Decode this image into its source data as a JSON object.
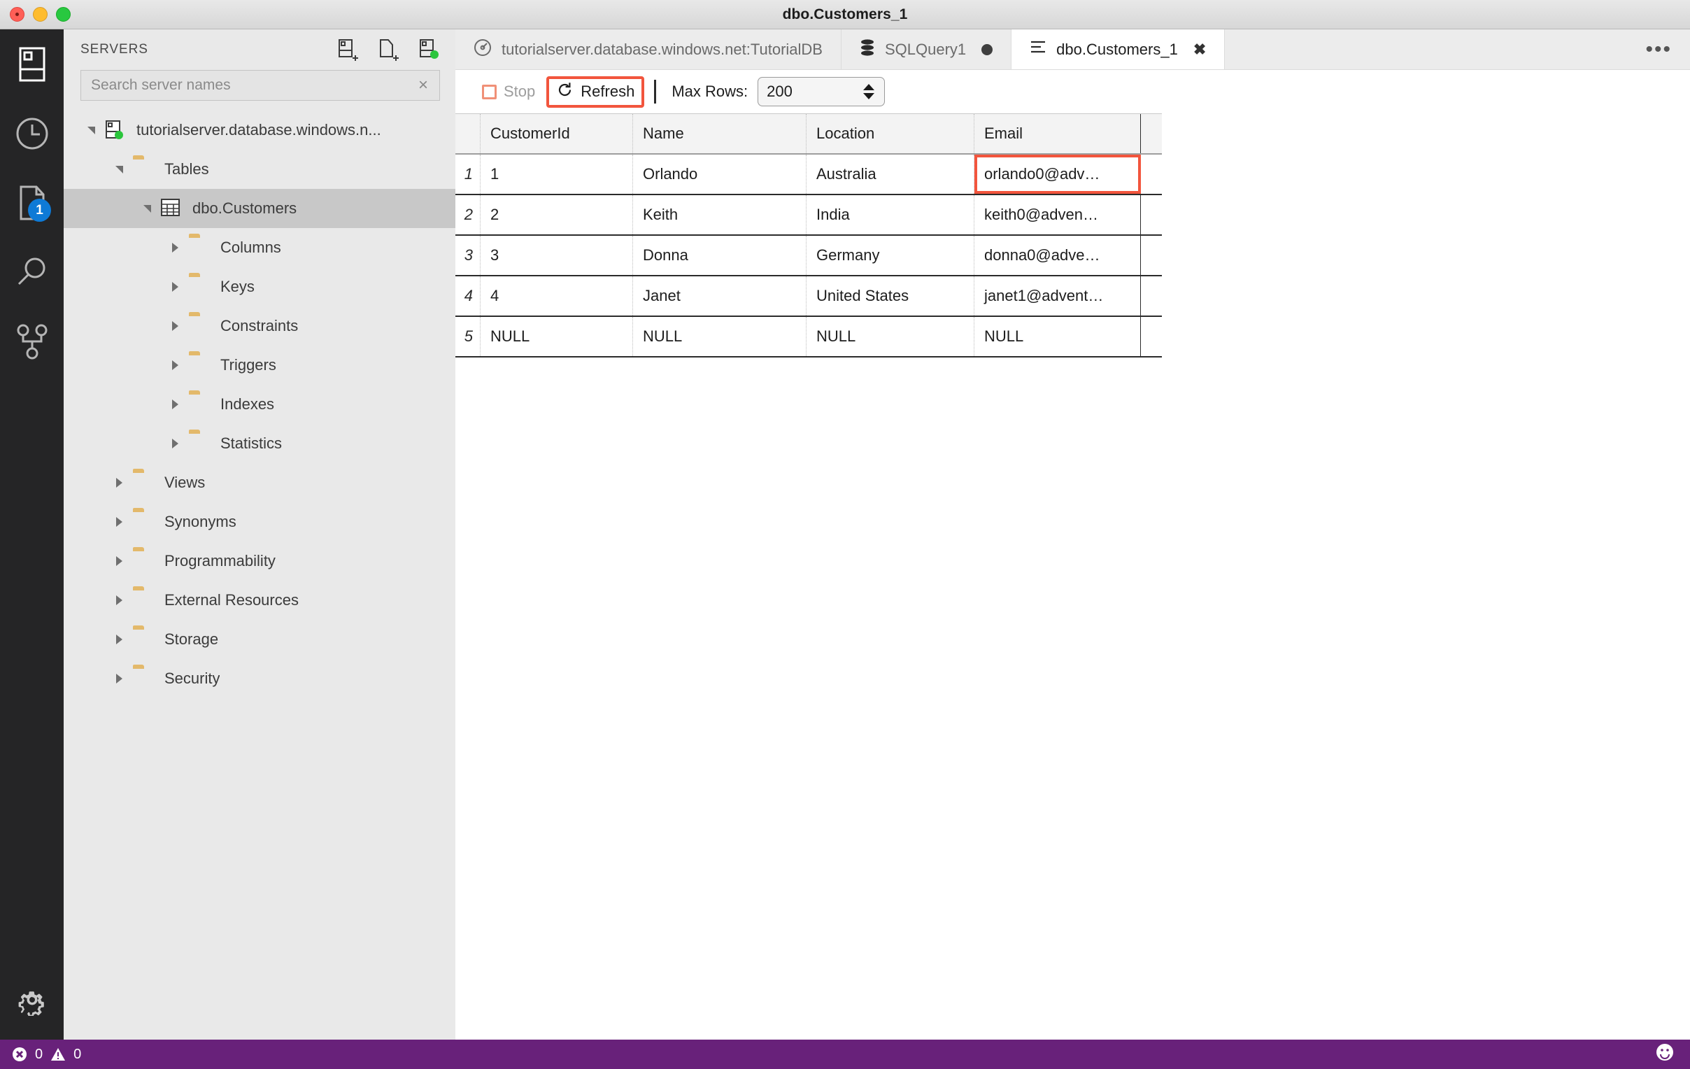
{
  "window": {
    "title": "dbo.Customers_1",
    "traffic_lights": [
      "close",
      "minimize",
      "maximize"
    ]
  },
  "activity_bar": {
    "items": [
      {
        "name": "servers-icon",
        "label": "Servers"
      },
      {
        "name": "history-icon",
        "label": "History"
      },
      {
        "name": "tasks-icon",
        "label": "Tasks",
        "badge": "1"
      },
      {
        "name": "search-icon",
        "label": "Search"
      },
      {
        "name": "source-control-icon",
        "label": "Source Control"
      }
    ],
    "bottom": {
      "name": "gear-icon",
      "label": "Manage"
    }
  },
  "sidebar": {
    "title": "SERVERS",
    "actions": [
      {
        "name": "new-connection-icon",
        "label": "New Connection"
      },
      {
        "name": "new-query-icon",
        "label": "New Query"
      },
      {
        "name": "new-server-group-icon",
        "label": "New Server Group"
      }
    ],
    "search": {
      "placeholder": "Search server names",
      "value": "",
      "clear": "×"
    },
    "tree": [
      {
        "label": "tutorialserver.database.windows.n...",
        "icon": "server-icon",
        "state": "open",
        "indent": 0,
        "selected": false
      },
      {
        "label": "Tables",
        "icon": "folder-icon",
        "state": "open",
        "indent": 1,
        "selected": false
      },
      {
        "label": "dbo.Customers",
        "icon": "table-icon",
        "state": "open",
        "indent": 2,
        "selected": true
      },
      {
        "label": "Columns",
        "icon": "folder-icon",
        "state": "closed",
        "indent": 3,
        "selected": false
      },
      {
        "label": "Keys",
        "icon": "folder-icon",
        "state": "closed",
        "indent": 3,
        "selected": false
      },
      {
        "label": "Constraints",
        "icon": "folder-icon",
        "state": "closed",
        "indent": 3,
        "selected": false
      },
      {
        "label": "Triggers",
        "icon": "folder-icon",
        "state": "closed",
        "indent": 3,
        "selected": false
      },
      {
        "label": "Indexes",
        "icon": "folder-icon",
        "state": "closed",
        "indent": 3,
        "selected": false
      },
      {
        "label": "Statistics",
        "icon": "folder-icon",
        "state": "closed",
        "indent": 3,
        "selected": false
      },
      {
        "label": "Views",
        "icon": "folder-icon",
        "state": "closed",
        "indent": 1,
        "selected": false
      },
      {
        "label": "Synonyms",
        "icon": "folder-icon",
        "state": "closed",
        "indent": 1,
        "selected": false
      },
      {
        "label": "Programmability",
        "icon": "folder-icon",
        "state": "closed",
        "indent": 1,
        "selected": false
      },
      {
        "label": "External Resources",
        "icon": "folder-icon",
        "state": "closed",
        "indent": 1,
        "selected": false
      },
      {
        "label": "Storage",
        "icon": "folder-icon",
        "state": "closed",
        "indent": 1,
        "selected": false
      },
      {
        "label": "Security",
        "icon": "folder-icon",
        "state": "closed",
        "indent": 1,
        "selected": false
      }
    ]
  },
  "editor": {
    "tabs": [
      {
        "label": "tutorialserver.database.windows.net:TutorialDB",
        "icon": "dashboard-icon",
        "active": false,
        "dirty": false,
        "closable": false
      },
      {
        "label": "SQLQuery1",
        "icon": "database-icon",
        "active": false,
        "dirty": true,
        "closable": false
      },
      {
        "label": "dbo.Customers_1",
        "icon": "table-edit-icon",
        "active": true,
        "dirty": false,
        "closable": true,
        "close": "✖"
      }
    ],
    "more_actions": "•••",
    "toolbar": {
      "stop_label": "Stop",
      "refresh_label": "Refresh",
      "max_rows_label": "Max Rows:",
      "max_rows_value": "200",
      "highlight_color": "#f2553d"
    },
    "grid": {
      "columns": [
        "CustomerId",
        "Name",
        "Location",
        "Email"
      ],
      "rows": [
        {
          "n": "1",
          "cells": [
            "1",
            "Orlando",
            "Australia",
            "orlando0@adv…"
          ]
        },
        {
          "n": "2",
          "cells": [
            "2",
            "Keith",
            "India",
            "keith0@adven…"
          ]
        },
        {
          "n": "3",
          "cells": [
            "3",
            "Donna",
            "Germany",
            "donna0@adve…"
          ]
        },
        {
          "n": "4",
          "cells": [
            "4",
            "Janet",
            "United States",
            "janet1@advent…"
          ]
        },
        {
          "n": "5",
          "cells": [
            "NULL",
            "NULL",
            "NULL",
            "NULL"
          ]
        }
      ],
      "selected_cell": {
        "row": 0,
        "col": 3
      }
    }
  },
  "status_bar": {
    "errors": "0",
    "warnings": "0",
    "feedback": "feedback-smiley",
    "background": "#68217a"
  }
}
